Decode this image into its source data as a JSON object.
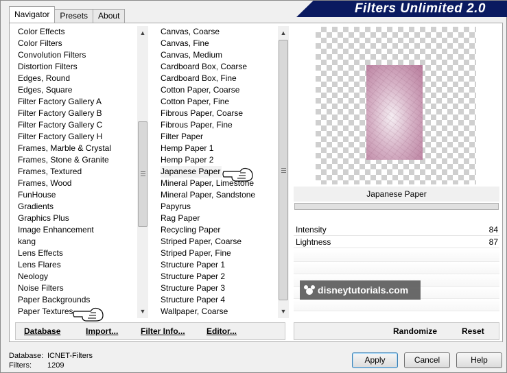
{
  "tabs": [
    "Navigator",
    "Presets",
    "About"
  ],
  "banner_title": "Filters Unlimited 2.0",
  "categories": [
    "Color Effects",
    "Color Filters",
    "Convolution Filters",
    "Distortion Filters",
    "Edges, Round",
    "Edges, Square",
    "Filter Factory Gallery A",
    "Filter Factory Gallery B",
    "Filter Factory Gallery C",
    "Filter Factory Gallery H",
    "Frames, Marble & Crystal",
    "Frames, Stone & Granite",
    "Frames, Textured",
    "Frames, Wood",
    "FunHouse",
    "Gradients",
    "Graphics Plus",
    "Image Enhancement",
    "kang",
    "Lens Effects",
    "Lens Flares",
    "Neology",
    "Noise Filters",
    "Paper Backgrounds",
    "Paper Textures"
  ],
  "filters": [
    "Canvas, Coarse",
    "Canvas, Fine",
    "Canvas, Medium",
    "Cardboard Box, Coarse",
    "Cardboard Box, Fine",
    "Cotton Paper, Coarse",
    "Cotton Paper, Fine",
    "Fibrous Paper, Coarse",
    "Fibrous Paper, Fine",
    "Filter Paper",
    "Hemp Paper 1",
    "Hemp Paper 2",
    "Japanese Paper",
    "Mineral Paper, Limestone",
    "Mineral Paper, Sandstone",
    "Papyrus",
    "Rag Paper",
    "Recycling Paper",
    "Striped Paper, Coarse",
    "Striped Paper, Fine",
    "Structure Paper 1",
    "Structure Paper 2",
    "Structure Paper 3",
    "Structure Paper 4",
    "Wallpaper, Coarse"
  ],
  "bottom_links": {
    "database": "Database",
    "import": "Import...",
    "filter_info": "Filter Info...",
    "editor": "Editor..."
  },
  "selected_filter": "Japanese Paper",
  "params": [
    {
      "label": "Intensity",
      "value": "84"
    },
    {
      "label": "Lightness",
      "value": "87"
    }
  ],
  "watermark": "disneytutorials.com",
  "right_buttons": {
    "randomize": "Randomize",
    "reset": "Reset"
  },
  "status": {
    "database_label": "Database:",
    "database_value": "ICNET-Filters",
    "filters_label": "Filters:",
    "filters_value": "1209"
  },
  "dialog_buttons": {
    "apply": "Apply",
    "cancel": "Cancel",
    "help": "Help"
  },
  "colors": {
    "banner": "#0a1a60",
    "preview_paper": "#d7b3c7"
  }
}
